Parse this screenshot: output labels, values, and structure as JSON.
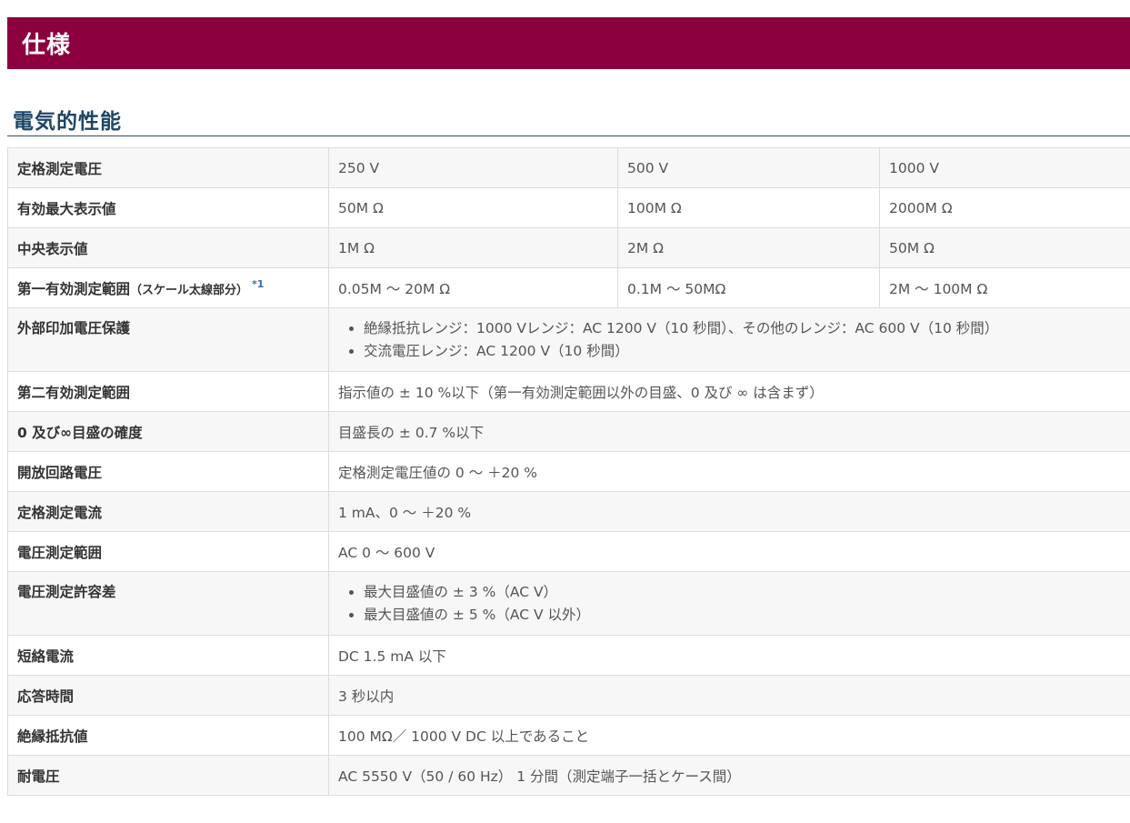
{
  "header": {
    "title": "仕様"
  },
  "section": {
    "title": "電気的性能"
  },
  "table": {
    "ranged_rows": [
      {
        "label": "定格測定電圧",
        "values": [
          "250 V",
          "500 V",
          "1000 V"
        ]
      },
      {
        "label": "有効最大表示値",
        "values": [
          "50M Ω",
          "100M Ω",
          "2000M Ω"
        ]
      },
      {
        "label": "中央表示値",
        "values": [
          "1M Ω",
          "2M Ω",
          "50M Ω"
        ]
      },
      {
        "label": "第一有効測定範囲",
        "label_note": "（スケール太線部分）",
        "footnote": "*1",
        "values": [
          "0.05M ～ 20M Ω",
          "0.1M ～ 50MΩ",
          "2M ～ 100M Ω"
        ]
      }
    ],
    "external_voltage": {
      "label": "外部印加電圧保護",
      "items": [
        "絶縁抵抗レンジ：1000 Vレンジ：AC 1200 V（10 秒間）、その他のレンジ：AC 600 V（10 秒間）",
        "交流電圧レンジ：AC 1200 V（10 秒間）"
      ]
    },
    "mid_rows": [
      {
        "label": "第二有効測定範囲",
        "value": "指示値の ± 10 %以下（第一有効測定範囲以外の目盛、0 及び ∞ は含まず）"
      },
      {
        "label": "0 及び∞目盛の確度",
        "value": "目盛長の ± 0.7 %以下"
      },
      {
        "label": "開放回路電圧",
        "value": "定格測定電圧値の 0 ～ ＋20 %"
      },
      {
        "label": "定格測定電流",
        "value": "1 mA、0 ～ ＋20 %"
      },
      {
        "label": "電圧測定範囲",
        "value": "AC 0 ～ 600 V"
      }
    ],
    "voltage_tolerance": {
      "label": "電圧測定許容差",
      "items": [
        "最大目盛値の ± 3 %（AC V）",
        "最大目盛値の ± 5 %（AC V 以外）"
      ]
    },
    "tail_rows": [
      {
        "label": "短絡電流",
        "value": "DC 1.5 mA 以下"
      },
      {
        "label": "応答時間",
        "value": "3 秒以内"
      },
      {
        "label": "絶縁抵抗値",
        "value": "100 MΩ／ 1000 V DC 以上であること"
      },
      {
        "label": "耐電圧",
        "value": "AC 5550 V（50 / 60 Hz） 1 分間（測定端子一括とケース間）"
      }
    ]
  },
  "colors": {
    "header_bg": "#8c0040",
    "section_title": "#1e4666",
    "footnote": "#3a6ea5"
  }
}
